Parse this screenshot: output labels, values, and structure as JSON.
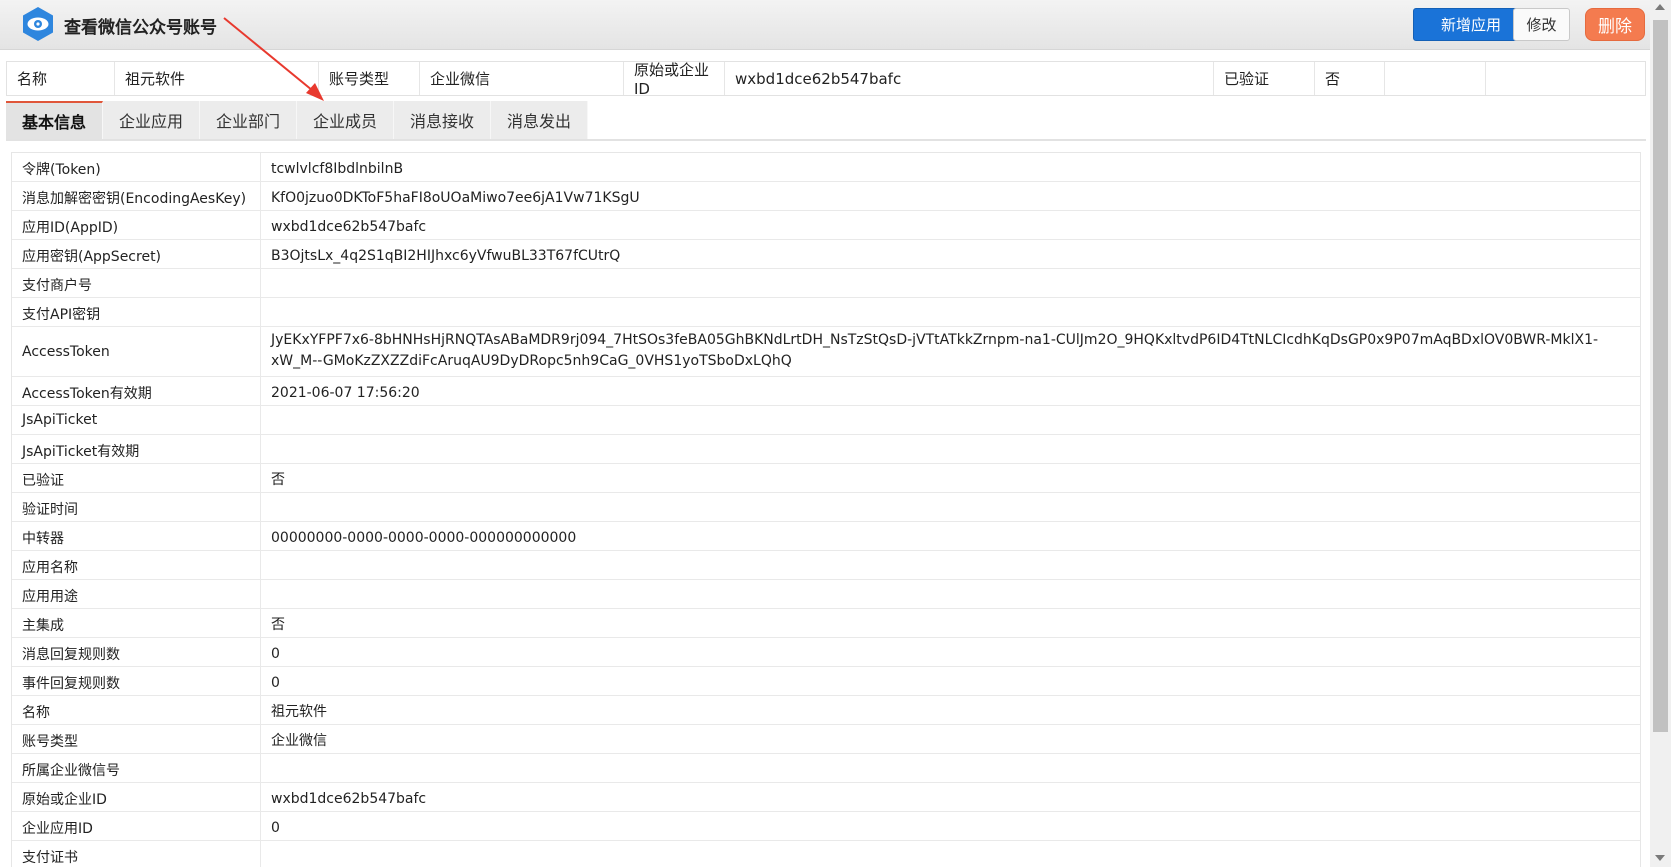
{
  "header": {
    "title": "查看微信公众号账号",
    "add_label": "新增应用",
    "edit_label": "修改",
    "delete_label": "删除"
  },
  "summary": {
    "name_label": "名称",
    "name_value": "祖元软件",
    "type_label": "账号类型",
    "type_value": "企业微信",
    "id_label": "原始或企业ID",
    "id_value": "wxbd1dce62b547bafc",
    "verified_label": "已验证",
    "verified_value": "否"
  },
  "tabs": [
    "基本信息",
    "企业应用",
    "企业部门",
    "企业成员",
    "消息接收",
    "消息发出"
  ],
  "details": [
    {
      "label": "令牌(Token)",
      "value": "tcwlvlcf8IbdlnbilnB"
    },
    {
      "label": "消息加解密密钥(EncodingAesKey)",
      "value": "KfO0jzuo0DKToF5haFI8oUOaMiwo7ee6jA1Vw71KSgU"
    },
    {
      "label": "应用ID(AppID)",
      "value": "wxbd1dce62b547bafc"
    },
    {
      "label": "应用密钥(AppSecret)",
      "value": "B3OjtsLx_4q2S1qBI2HIJhxc6yVfwuBL33T67fCUtrQ"
    },
    {
      "label": "支付商户号",
      "value": ""
    },
    {
      "label": "支付API密钥",
      "value": ""
    },
    {
      "label": "AccessToken",
      "value": "JyEKxYFPF7x6-8bHNHsHjRNQTAsABaMDR9rj094_7HtSOs3feBA05GhBKNdLrtDH_NsTzStQsD-jVTtATkkZrnpm-na1-CUlJm2O_9HQKxltvdP6ID4TtNLCIcdhKqDsGP0x9P07mAqBDxlOV0BWR-MklX1-xW_M--GMoKzZXZZdiFcAruqAU9DyDRopc5nh9CaG_0VHS1yoTSboDxLQhQ"
    },
    {
      "label": "AccessToken有效期",
      "value": "2021-06-07 17:56:20"
    },
    {
      "label": "JsApiTicket",
      "value": ""
    },
    {
      "label": "JsApiTicket有效期",
      "value": ""
    },
    {
      "label": "已验证",
      "value": "否"
    },
    {
      "label": "验证时间",
      "value": ""
    },
    {
      "label": "中转器",
      "value": "00000000-0000-0000-0000-000000000000"
    },
    {
      "label": "应用名称",
      "value": ""
    },
    {
      "label": "应用用途",
      "value": ""
    },
    {
      "label": "主集成",
      "value": "否"
    },
    {
      "label": "消息回复规则数",
      "value": "0"
    },
    {
      "label": "事件回复规则数",
      "value": "0"
    },
    {
      "label": "名称",
      "value": "祖元软件"
    },
    {
      "label": "账号类型",
      "value": "企业微信"
    },
    {
      "label": "所属企业微信号",
      "value": ""
    },
    {
      "label": "原始或企业ID",
      "value": "wxbd1dce62b547bafc"
    },
    {
      "label": "企业应用ID",
      "value": "0"
    },
    {
      "label": "支付证书",
      "value": ""
    }
  ],
  "colors": {
    "primary": "#1a73d8",
    "danger": "#f47b4f",
    "active_tab_accent": "#e0563a",
    "annotation_arrow": "#e8392e"
  },
  "icons": {
    "logo": "eye-logo-icon",
    "annotation": "red-arrow-annotation"
  }
}
